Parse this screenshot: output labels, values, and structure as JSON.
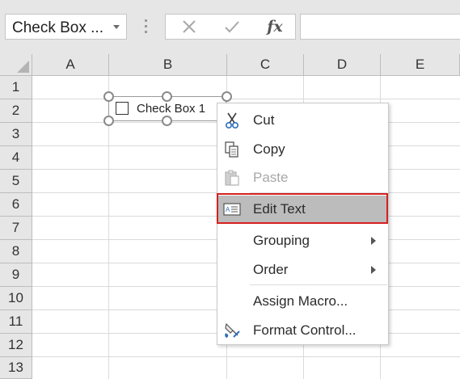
{
  "name_box": {
    "value": "Check Box ..."
  },
  "formula_bar": {
    "cancel_icon": "x-icon",
    "enter_icon": "checkmark-icon",
    "fx_label": "fx",
    "formula_value": ""
  },
  "columns": [
    "A",
    "B",
    "C",
    "D",
    "E"
  ],
  "rows": [
    "1",
    "2",
    "3",
    "4",
    "5",
    "6",
    "7",
    "8",
    "9",
    "10",
    "11",
    "12",
    "13"
  ],
  "checkbox_control": {
    "label": "Check Box 1"
  },
  "context_menu": {
    "items": [
      {
        "label": "Cut",
        "icon": "scissors-icon",
        "enabled": true
      },
      {
        "label": "Copy",
        "icon": "copy-icon",
        "enabled": true
      },
      {
        "label": "Paste",
        "icon": "paste-icon",
        "enabled": false
      },
      {
        "label": "Edit Text",
        "icon": "edit-text-icon",
        "enabled": true,
        "highlighted": true
      },
      {
        "label": "Grouping",
        "submenu": true,
        "enabled": true
      },
      {
        "label": "Order",
        "submenu": true,
        "enabled": true
      },
      {
        "label": "Assign Macro...",
        "enabled": true
      },
      {
        "label": "Format Control...",
        "icon": "format-control-icon",
        "enabled": true
      }
    ]
  },
  "colors": {
    "highlight_border": "#d62020",
    "menu_hover": "#bcbcbc",
    "header_bg": "#e6e6e6"
  }
}
